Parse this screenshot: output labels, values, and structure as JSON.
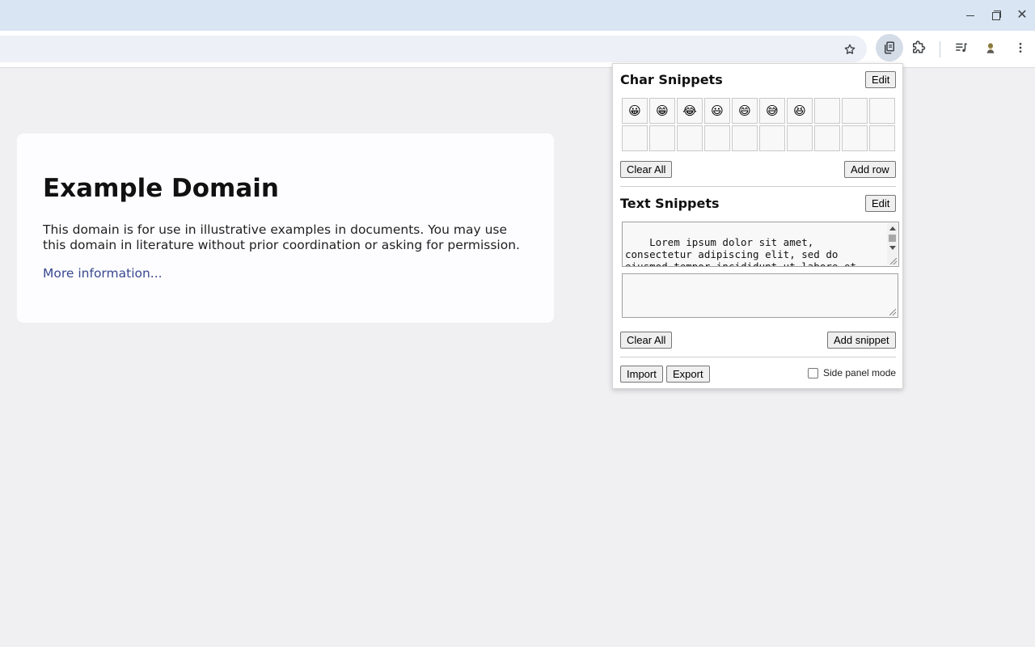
{
  "page": {
    "heading": "Example Domain",
    "paragraph": "This domain is for use in illustrative examples in documents. You may use this domain in literature without prior coordination or asking for permission.",
    "link": "More information..."
  },
  "popup": {
    "char_snippets": {
      "title": "Char Snippets",
      "edit_label": "Edit",
      "chars": [
        "😀",
        "😁",
        "😂",
        "😃",
        "😄",
        "😅",
        "😆",
        "",
        "",
        "",
        "",
        "",
        "",
        "",
        "",
        "",
        "",
        "",
        "",
        ""
      ],
      "clear_label": "Clear All",
      "add_row_label": "Add row"
    },
    "text_snippets": {
      "title": "Text Snippets",
      "edit_label": "Edit",
      "snippet_text": "Lorem ipsum dolor sit amet, consectetur adipiscing elit, sed do eiusmod tempor incididunt ut labore et dolore magna aliqua. Ut enim ad minim veniam, quis",
      "clear_label": "Clear All",
      "add_snippet_label": "Add snippet"
    },
    "footer": {
      "import_label": "Import",
      "export_label": "Export",
      "side_panel_label": "Side panel mode",
      "side_panel_checked": false
    }
  },
  "icons": {
    "bookmark": "star-icon",
    "active_extension": "clipboard-icon",
    "extensions": "puzzle-icon",
    "media": "media-control-icon",
    "profile": "avatar",
    "menu": "kebab-menu-icon"
  }
}
